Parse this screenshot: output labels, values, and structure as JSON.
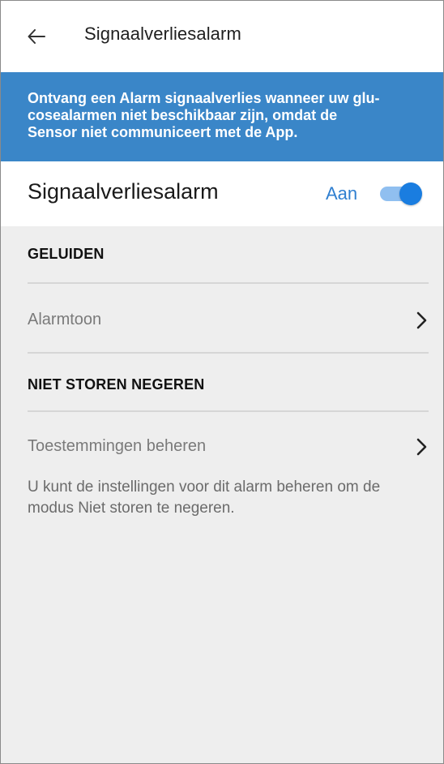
{
  "header": {
    "back_icon": "arrow-left-icon",
    "title": "Signaalverliesalarm"
  },
  "banner": {
    "text": "Ontvang een Alarm signaalverlies wanneer uw glu-cosealarmen niet beschikbaar zijn, omdat de Sensor niet communiceert met de App.",
    "line1": "Ontvang een Alarm signaalverlies wanneer uw glu-",
    "line2": "cosealarmen niet beschikbaar zijn, omdat de",
    "line3": "Sensor niet communiceert met de App.",
    "color": "#3a86c8"
  },
  "toggle": {
    "label": "Signaalverliesalarm",
    "state_label": "Aan",
    "on": true,
    "accent": "#1a7de0"
  },
  "sections": {
    "sounds": {
      "header": "GELUIDEN",
      "item_label": "Alarmtoon",
      "item_icon": "chevron-right-icon"
    },
    "dnd": {
      "header": "NIET STOREN NEGEREN",
      "item_label": "Toestemmingen beheren",
      "item_icon": "chevron-right-icon",
      "helper": "U kunt de instellingen voor dit alarm beheren om de modus Niet storen te negeren.",
      "helper_line1": "U kunt de instellingen voor dit alarm beheren om de",
      "helper_line2": "modus Niet storen te negeren."
    }
  }
}
